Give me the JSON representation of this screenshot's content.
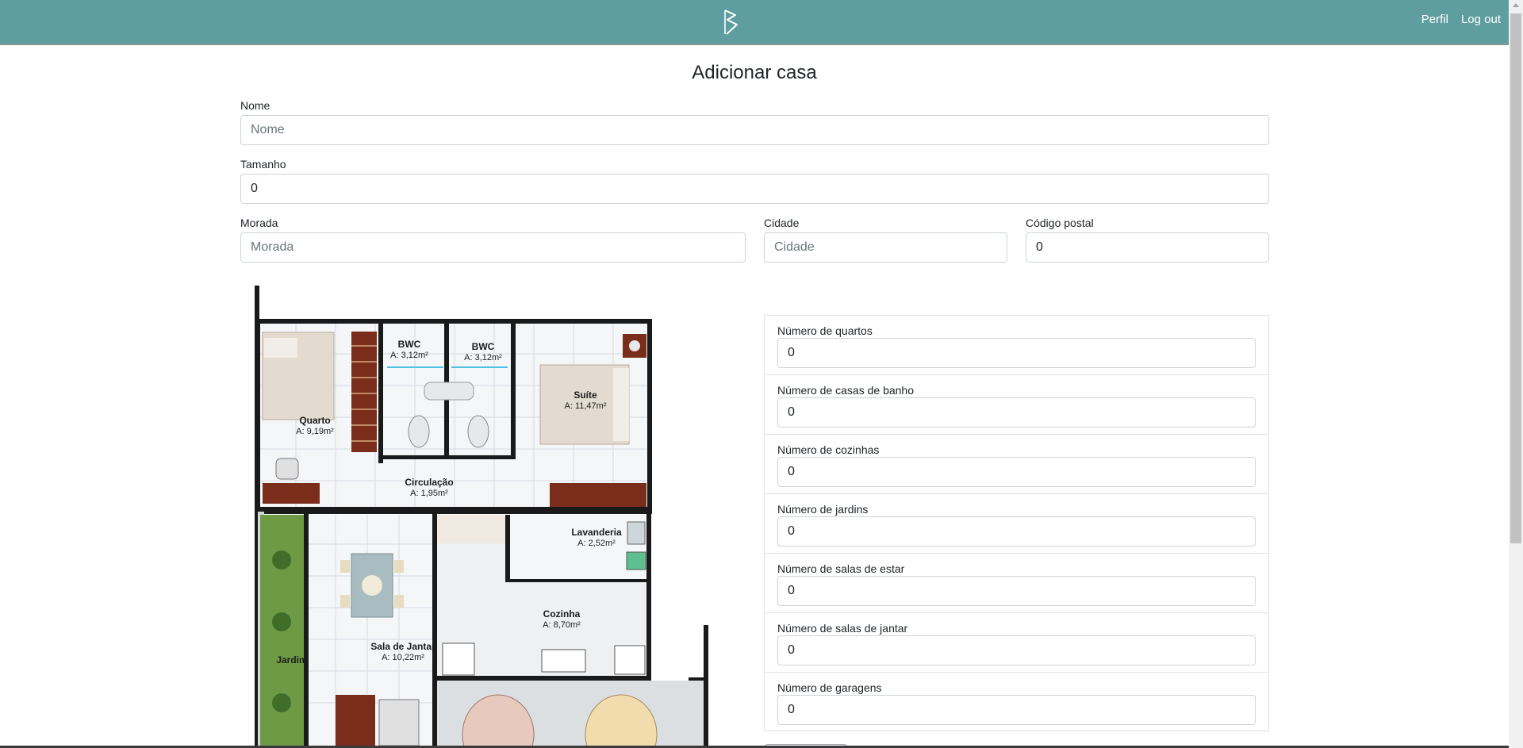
{
  "nav": {
    "perfil": "Perfil",
    "logout": "Log out",
    "logo_icon": "ea-logo-icon"
  },
  "page": {
    "title": "Adicionar casa"
  },
  "form": {
    "nome": {
      "label": "Nome",
      "placeholder": "Nome",
      "value": ""
    },
    "tamanho": {
      "label": "Tamanho",
      "value": "0"
    },
    "morada": {
      "label": "Morada",
      "placeholder": "Morada",
      "value": ""
    },
    "cidade": {
      "label": "Cidade",
      "placeholder": "Cidade",
      "value": ""
    },
    "codigo_postal": {
      "label": "Código postal",
      "value": "0"
    }
  },
  "counts": [
    {
      "label": "Número de quartos",
      "value": "0"
    },
    {
      "label": "Número de casas de banho",
      "value": "0"
    },
    {
      "label": "Número de cozinhas",
      "value": "0"
    },
    {
      "label": "Número de jardins",
      "value": "0"
    },
    {
      "label": "Número de salas de estar",
      "value": "0"
    },
    {
      "label": "Número de salas de jantar",
      "value": "0"
    },
    {
      "label": "Número de garagens",
      "value": "0"
    }
  ],
  "floor_plan": {
    "rooms": [
      {
        "name": "Quarto",
        "area": "A: 9,19m²"
      },
      {
        "name": "BWC",
        "area": "A: 3,12m²"
      },
      {
        "name": "BWC",
        "area": "A: 3,12m²"
      },
      {
        "name": "Suíte",
        "area": "A: 11,47m²"
      },
      {
        "name": "Circulação",
        "area": "A: 1,95m²"
      },
      {
        "name": "Lavanderia",
        "area": "A: 2,52m²"
      },
      {
        "name": "Cozinha",
        "area": "A: 8,70m²"
      },
      {
        "name": "Sala de Jantar",
        "area": "A: 10,22m²"
      },
      {
        "name": "Jardim",
        "area": ""
      }
    ]
  },
  "colors": {
    "navbar": "#5f9ea0",
    "wall": "#1a1a1a",
    "garden": "#6f9a45",
    "wood": "#7a2d1a"
  }
}
